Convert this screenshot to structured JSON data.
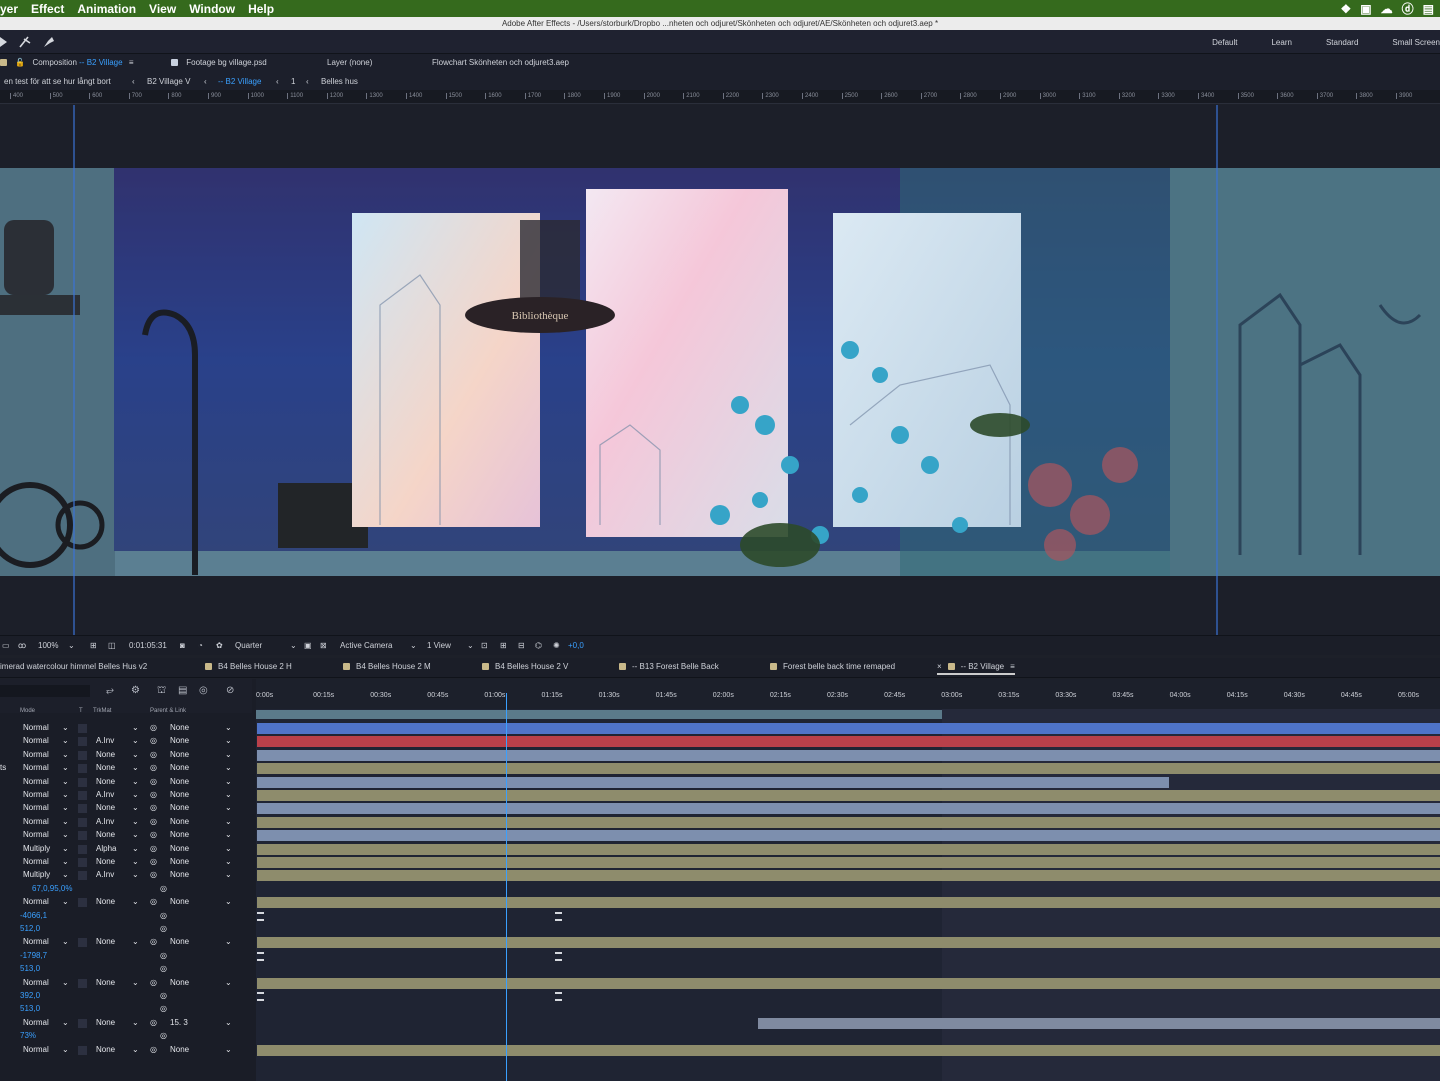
{
  "menu": {
    "items": [
      "yer",
      "Effect",
      "Animation",
      "View",
      "Window",
      "Help"
    ]
  },
  "window": {
    "title": "Adobe After Effects - /Users/storburk/Dropbo ...nheten och odjuret/Skönheten och odjuret/AE/Skönheten och odjuret3.aep *"
  },
  "workspaces": [
    "Default",
    "Learn",
    "Standard",
    "Small Screen"
  ],
  "panel_tabs": {
    "composition_prefix": "Composition",
    "composition_name": "-- B2 Village",
    "footage": "Footage bg village.psd",
    "layer": "Layer (none)",
    "flowchart": "Flowchart Skönheten och odjuret3.aep"
  },
  "breadcrumbs": [
    "en test för att se hur långt bort",
    "B2 Village V",
    "-- B2 Village",
    "1",
    "Belles hus"
  ],
  "ruler_ticks": [
    "400",
    "500",
    "600",
    "700",
    "800",
    "900",
    "1000",
    "1100",
    "1200",
    "1300",
    "1400",
    "1500",
    "1600",
    "1700",
    "1800",
    "1900",
    "2000",
    "2100",
    "2200",
    "2300",
    "2400",
    "2500",
    "2600",
    "2700",
    "2800",
    "2900",
    "3000",
    "3100",
    "3200",
    "3300",
    "3400",
    "3500",
    "3600",
    "3700",
    "3800",
    "3900"
  ],
  "viewer_bar": {
    "zoom": "100%",
    "timecode": "0:01:05:31",
    "resolution": "Quarter",
    "camera": "Active Camera",
    "views": "1 View",
    "exposure": "+0,0"
  },
  "viewer": {
    "sign_text": "Bibliothèque"
  },
  "timeline_tabs": [
    "imerad watercolour himmel Belles Hus v2",
    "B4 Belles House 2 H",
    "B4 Belles House 2 M",
    "B4 Belles House 2 V",
    "-- B13 Forest Belle Back",
    "Forest belle back time remaped",
    "-- B2 Village"
  ],
  "timeline": {
    "columns": {
      "mode": "Mode",
      "t": "T",
      "trkmat": "TrkMat",
      "parent": "Parent & Link"
    },
    "time_labels": [
      "0:00s",
      "00:15s",
      "00:30s",
      "00:45s",
      "01:00s",
      "01:15s",
      "01:30s",
      "01:45s",
      "02:00s",
      "02:15s",
      "02:30s",
      "02:45s",
      "03:00s",
      "03:15s",
      "03:30s",
      "03:45s",
      "04:00s",
      "04:15s",
      "04:30s",
      "04:45s",
      "05:00s"
    ],
    "rows": [
      {
        "mode": "Normal",
        "trkmat": "",
        "parent": "None"
      },
      {
        "mode": "Normal",
        "trkmat": "A.Inv",
        "parent": "None"
      },
      {
        "mode": "Normal",
        "trkmat": "None",
        "parent": "None"
      },
      {
        "mode": "Normal",
        "trkmat": "None",
        "parent": "None",
        "prefix": "ts"
      },
      {
        "mode": "Normal",
        "trkmat": "None",
        "parent": "None"
      },
      {
        "mode": "Normal",
        "trkmat": "A.Inv",
        "parent": "None"
      },
      {
        "mode": "Normal",
        "trkmat": "None",
        "parent": "None"
      },
      {
        "mode": "Normal",
        "trkmat": "A.Inv",
        "parent": "None"
      },
      {
        "mode": "Normal",
        "trkmat": "None",
        "parent": "None"
      },
      {
        "mode": "Multiply",
        "trkmat": "Alpha",
        "parent": "None"
      },
      {
        "mode": "Normal",
        "trkmat": "None",
        "parent": "None"
      },
      {
        "mode": "Multiply",
        "trkmat": "A.Inv",
        "parent": "None"
      },
      {
        "value": "67,0,95,0%"
      },
      {
        "mode": "Normal",
        "trkmat": "None",
        "parent": "None"
      },
      {
        "value": "-4066,1"
      },
      {
        "value": "512,0"
      },
      {
        "mode": "Normal",
        "trkmat": "None",
        "parent": "None"
      },
      {
        "value": "-1798,7"
      },
      {
        "value": "513,0"
      },
      {
        "mode": "Normal",
        "trkmat": "None",
        "parent": "None"
      },
      {
        "value": "392,0"
      },
      {
        "value": "513,0"
      },
      {
        "mode": "Normal",
        "trkmat": "None",
        "parent": "15. 3"
      },
      {
        "value": "73%"
      },
      {
        "mode": "Normal",
        "trkmat": "None",
        "parent": "None"
      }
    ]
  },
  "colors": {
    "menubar": "#356a1d",
    "accent": "#3aa0ff",
    "bar_blue": "#4f74c9",
    "bar_red": "#b9404a",
    "bar_olive": "#8e8c6c",
    "bar_lightblue": "#7d8fae"
  }
}
